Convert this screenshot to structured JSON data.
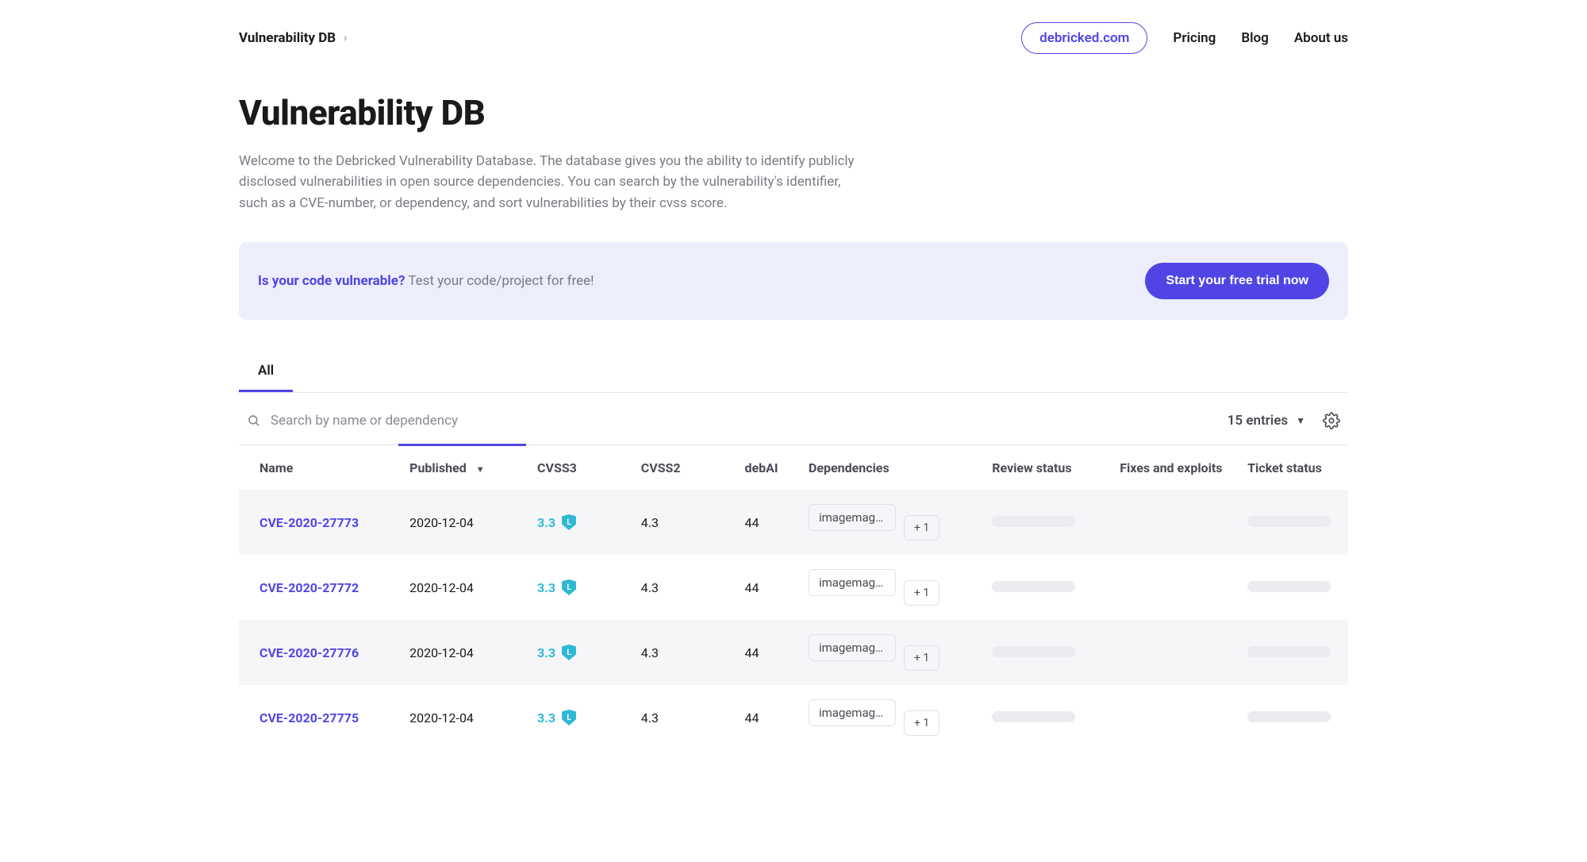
{
  "breadcrumb": {
    "label": "Vulnerability DB"
  },
  "nav": {
    "site_link": "debricked.com",
    "pricing": "Pricing",
    "blog": "Blog",
    "about": "About us"
  },
  "header": {
    "title": "Vulnerability DB",
    "description": "Welcome to the Debricked Vulnerability Database. The database gives you the ability to identify publicly disclosed vulnerabilities in open source dependencies. You can search by the vulnerability's identifier, such as a CVE-number, or dependency, and sort vulnerabilities by their cvss score."
  },
  "cta": {
    "lead": "Is your code vulnerable?",
    "rest": " Test your code/project for free!",
    "button": "Start your free trial now"
  },
  "tabs": {
    "all": "All"
  },
  "search": {
    "placeholder": "Search by name or dependency"
  },
  "toolbar": {
    "entries_label": "15 entries"
  },
  "columns": {
    "name": "Name",
    "published": "Published",
    "cvss3": "CVSS3",
    "cvss2": "CVSS2",
    "debai": "debAI",
    "deps": "Dependencies",
    "review": "Review status",
    "fixes": "Fixes and exploits",
    "ticket": "Ticket status"
  },
  "severity_badge": "L",
  "rows": [
    {
      "name": "CVE-2020-27773",
      "published": "2020-12-04",
      "cvss3": "3.3",
      "cvss2": "4.3",
      "debai": "44",
      "dep": "imagemagi…",
      "dep_extra": "+ 1"
    },
    {
      "name": "CVE-2020-27772",
      "published": "2020-12-04",
      "cvss3": "3.3",
      "cvss2": "4.3",
      "debai": "44",
      "dep": "imagemagi…",
      "dep_extra": "+ 1"
    },
    {
      "name": "CVE-2020-27776",
      "published": "2020-12-04",
      "cvss3": "3.3",
      "cvss2": "4.3",
      "debai": "44",
      "dep": "imagemagi…",
      "dep_extra": "+ 1"
    },
    {
      "name": "CVE-2020-27775",
      "published": "2020-12-04",
      "cvss3": "3.3",
      "cvss2": "4.3",
      "debai": "44",
      "dep": "imagemagi…",
      "dep_extra": "+ 1"
    }
  ]
}
